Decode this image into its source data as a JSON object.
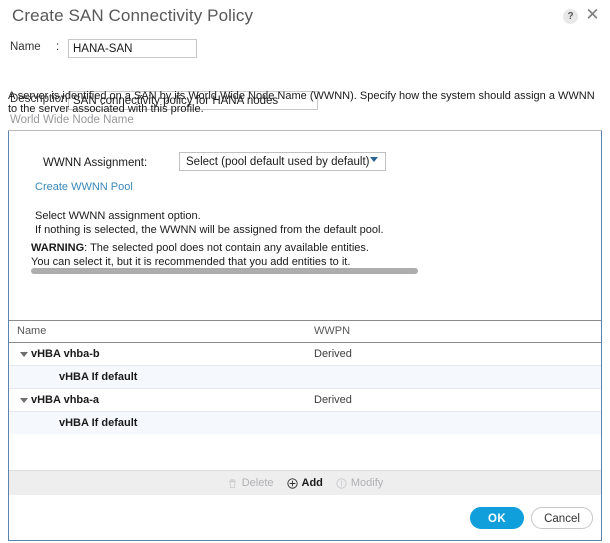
{
  "dialog": {
    "title": "Create SAN Connectivity Policy",
    "help_icon": "?",
    "close_icon": "✕"
  },
  "form": {
    "name": {
      "label": "Name",
      "separator": ":",
      "value": "HANA-SAN",
      "placeholder": ""
    },
    "description": {
      "label": "Description",
      "separator": ":",
      "value": "SAN connectivity policy for HANA nodes",
      "placeholder": ""
    },
    "blurb": "A server is identified on a SAN by its World Wide Node Name (WWNN). Specify how the system should assign a WWNN to the server associated with this profile.",
    "section_label": "World Wide Node Name"
  },
  "wwnn": {
    "assignment_label": "WWNN Assignment:",
    "assignment_value": "Select (pool default used by default)",
    "assignment_options": [
      "Select (pool default used by default)"
    ],
    "create_pool_link": "Create WWNN Pool",
    "hint_line1": "Select WWNN assignment option.",
    "hint_line2": "If nothing is selected, the WWNN will be assigned from the default pool.",
    "warning_label": "WARNING",
    "warning_line1": ": The selected pool does not contain any available entities.",
    "warning_line2": "You can select it, but it is recommended that you add entities to it."
  },
  "table": {
    "columns": [
      "Name",
      "WWPN"
    ],
    "rows": [
      {
        "name": "vHBA vhba-b",
        "wwpn": "Derived",
        "level": 0,
        "expanded": true
      },
      {
        "name": "vHBA If default",
        "wwpn": "",
        "level": 1,
        "expanded": false
      },
      {
        "name": "vHBA vhba-a",
        "wwpn": "Derived",
        "level": 0,
        "expanded": true
      },
      {
        "name": "vHBA If default",
        "wwpn": "",
        "level": 1,
        "expanded": false
      }
    ],
    "toolbar": {
      "delete_label": "Delete",
      "add_label": "Add",
      "modify_label": "Modify"
    }
  },
  "footer": {
    "ok_label": "OK",
    "cancel_label": "Cancel"
  },
  "colors": {
    "accent_blue": "#119fdc",
    "link_blue": "#3a87b8",
    "panel_border": "#5c83ad",
    "row_alt": "#f5f9fd"
  }
}
